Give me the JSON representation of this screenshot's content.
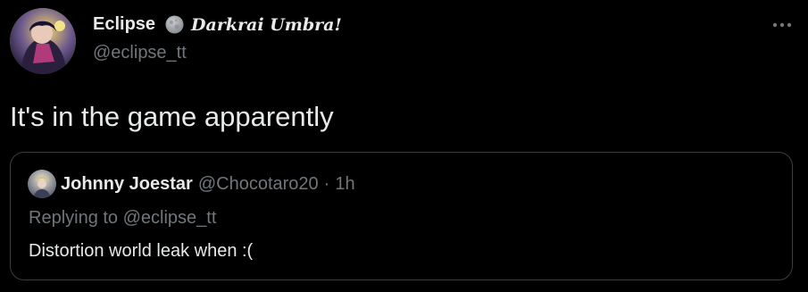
{
  "tweet": {
    "author": {
      "display_name": "Eclipse",
      "badge_icon": "moon-icon",
      "display_name_extra": "Darkrai Umbra!",
      "handle": "@eclipse_tt"
    },
    "more_icon": "more-horizontal-icon",
    "text": "It's in the game apparently"
  },
  "quoted_tweet": {
    "author": {
      "display_name": "Johnny Joestar",
      "handle": "@Chocotaro20"
    },
    "separator": "·",
    "time": "1h",
    "replying_to": "Replying to @eclipse_tt",
    "text": "Distortion world leak when :("
  },
  "colors": {
    "background": "#000000",
    "primary_text": "#e7e9ea",
    "secondary_text": "#71767b",
    "border": "#3a3d41"
  }
}
